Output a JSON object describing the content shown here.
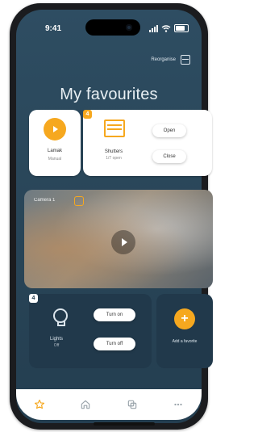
{
  "status_bar": {
    "time": "9:41"
  },
  "header": {
    "reorganize_label": "Reorganise",
    "title": "My favourites"
  },
  "tiles": {
    "lamp": {
      "label": "Lamak",
      "sublabel": "Manual"
    },
    "shutters": {
      "badge": "4",
      "label": "Shutters",
      "sublabel": "1/7 open",
      "open_label": "Open",
      "close_label": "Close"
    },
    "camera": {
      "label": "Camera 1"
    },
    "lights": {
      "badge": "4",
      "label": "Lights",
      "sublabel": "Off",
      "on_label": "Turn on",
      "off_label": "Turn off"
    },
    "add_favorite": {
      "label": "Add a favorite"
    }
  },
  "colors": {
    "accent": "#f6a81f",
    "background": "#2e4d62",
    "card": "#ffffff",
    "dark_card": "#21394b"
  },
  "nav": {
    "items": [
      {
        "name": "favorites",
        "icon": "star-icon",
        "active": true
      },
      {
        "name": "home",
        "icon": "home-icon"
      },
      {
        "name": "devices",
        "icon": "devices-icon"
      },
      {
        "name": "more",
        "icon": "more-icon"
      }
    ]
  }
}
